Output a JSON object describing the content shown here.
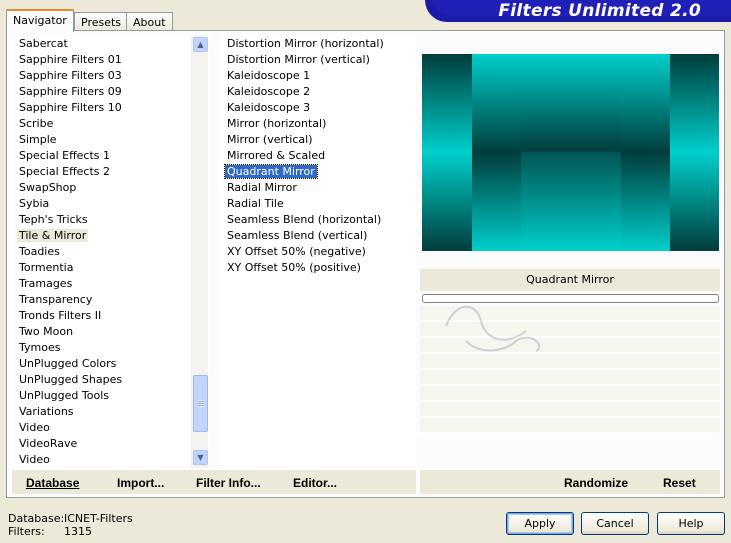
{
  "app": {
    "title": "Filters Unlimited 2.0"
  },
  "tabs": [
    {
      "label": "Navigator",
      "active": true
    },
    {
      "label": "Presets",
      "active": false
    },
    {
      "label": "About",
      "active": false
    }
  ],
  "categories": {
    "items": [
      "Sabercat",
      "Sapphire Filters 01",
      "Sapphire Filters 03",
      "Sapphire Filters 09",
      "Sapphire Filters 10",
      "Scribe",
      "Simple",
      "Special Effects 1",
      "Special Effects 2",
      "SwapShop",
      "Sybia",
      "Teph's Tricks",
      "Tile & Mirror",
      "Toadies",
      "Tormentia",
      "Tramages",
      "Transparency",
      "Tronds Filters II",
      "Two Moon",
      "Tymoes",
      "UnPlugged Colors",
      "UnPlugged Shapes",
      "UnPlugged Tools",
      "Variations",
      "Video",
      "VideoRave",
      "Video"
    ],
    "selected": "Tile & Mirror"
  },
  "filters": {
    "items": [
      "Distortion Mirror (horizontal)",
      "Distortion Mirror (vertical)",
      "Kaleidoscope 1",
      "Kaleidoscope 2",
      "Kaleidoscope 3",
      "Mirror (horizontal)",
      "Mirror (vertical)",
      "Mirrored & Scaled",
      "Quadrant Mirror",
      "Radial Mirror",
      "Radial Tile",
      "Seamless Blend (horizontal)",
      "Seamless Blend (vertical)",
      "XY Offset 50% (negative)",
      "XY Offset 50% (positive)"
    ],
    "selected": "Quadrant Mirror"
  },
  "preview": {
    "title": "Quadrant Mirror",
    "colors": {
      "teal": "#00cfcb",
      "dark": "#003d3c"
    }
  },
  "toolbar": {
    "database": "Database",
    "import": "Import...",
    "filter_info": "Filter Info...",
    "editor": "Editor...",
    "randomize": "Randomize",
    "reset": "Reset"
  },
  "status": {
    "database_label": "Database:",
    "database_value": "ICNET-Filters",
    "filters_label": "Filters:",
    "filters_value": "1315"
  },
  "buttons": {
    "apply": "Apply",
    "cancel": "Cancel",
    "help": "Help"
  },
  "colors": {
    "banner": "#1b1ba8",
    "selection": "#316ac5",
    "face": "#ece9d8"
  }
}
